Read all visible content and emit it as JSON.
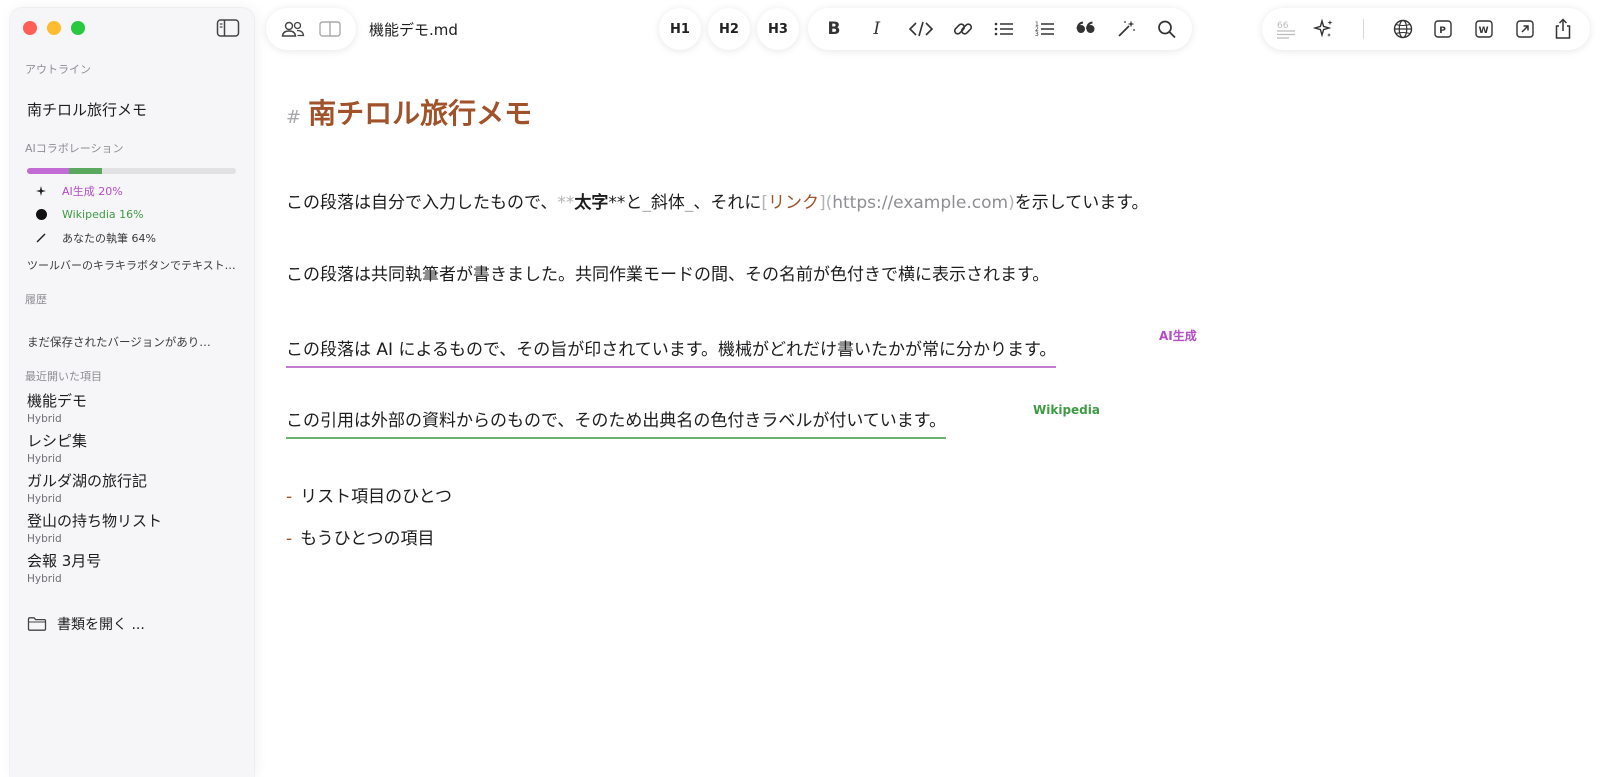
{
  "document": {
    "filename": "機能デモ.md"
  },
  "sidebar": {
    "outline_label": "アウトライン",
    "outline_items": [
      "南チロル旅行メモ"
    ],
    "ai_label": "AIコラボレーション",
    "ai_breakdown": [
      {
        "label": "AI生成 20%",
        "percent": 20,
        "color": "#c26bd4",
        "icon": "sparkle-icon"
      },
      {
        "label": "Wikipedia 16%",
        "percent": 16,
        "color": "#5aa85e",
        "icon": "dot-icon"
      },
      {
        "label": "あなたの執筆 64%",
        "percent": 64,
        "color": "#e1e0e3",
        "icon": "pencil-icon"
      }
    ],
    "ai_hint": "ツールバーのキラキラボタンでテキストを…",
    "history_label": "履歴",
    "history_empty": "まだ保存されたバージョンがあり…",
    "recent_label": "最近開いた項目",
    "recent_items": [
      {
        "title": "機能デモ",
        "subtitle": "Hybrid"
      },
      {
        "title": "レシピ集",
        "subtitle": "Hybrid"
      },
      {
        "title": "ガルダ湖の旅行記",
        "subtitle": "Hybrid"
      },
      {
        "title": "登山の持ち物リスト",
        "subtitle": "Hybrid"
      },
      {
        "title": "会報 3月号",
        "subtitle": "Hybrid"
      }
    ],
    "open_documents": "書類を開く ..."
  },
  "toolbar": {
    "heading_buttons": [
      "H1",
      "H2",
      "H3"
    ],
    "format_icons": [
      "bold-icon",
      "italic-icon",
      "code-icon",
      "link-icon",
      "bullet-list-icon",
      "numbered-list-icon",
      "quote-icon",
      "magic-wand-icon",
      "search-icon"
    ],
    "bold_glyph": "B",
    "italic_glyph": "I"
  },
  "editor": {
    "heading_marker": "#",
    "heading": "南チロル旅行メモ",
    "paragraph1": {
      "before": "この段落は自分で入力したもので、",
      "bold_open": "**",
      "bold_text": "太字",
      "bold_close": "**",
      "middle": "と",
      "italic_open": "_",
      "italic_text": "斜体",
      "italic_close": "_",
      "middle2": "、それに",
      "link_open": "[",
      "link_text": "リンク",
      "link_mid": "](",
      "link_url": "https://example.com",
      "link_close": ")",
      "after": "を示しています。"
    },
    "paragraph2": "この段落は共同執筆者が書きました。共同作業モードの間、その名前が色付きで横に表示されます。",
    "paragraph3": "この段落は AI によるもので、その旨が印されています。機械がどれだけ書いたかが常に分かります。",
    "paragraph3_label": "AI生成",
    "paragraph4": "この引用は外部の資料からのもので、そのため出典名の色付きラベルが付いています。",
    "paragraph4_label": "Wikipedia",
    "list_marker": "-",
    "list_items": [
      "リスト項目のひとつ",
      "もうひとつの項目"
    ]
  },
  "colors": {
    "accent": "#a0532b",
    "ai": "#b44cc8",
    "wikipedia": "#3f9a45"
  }
}
